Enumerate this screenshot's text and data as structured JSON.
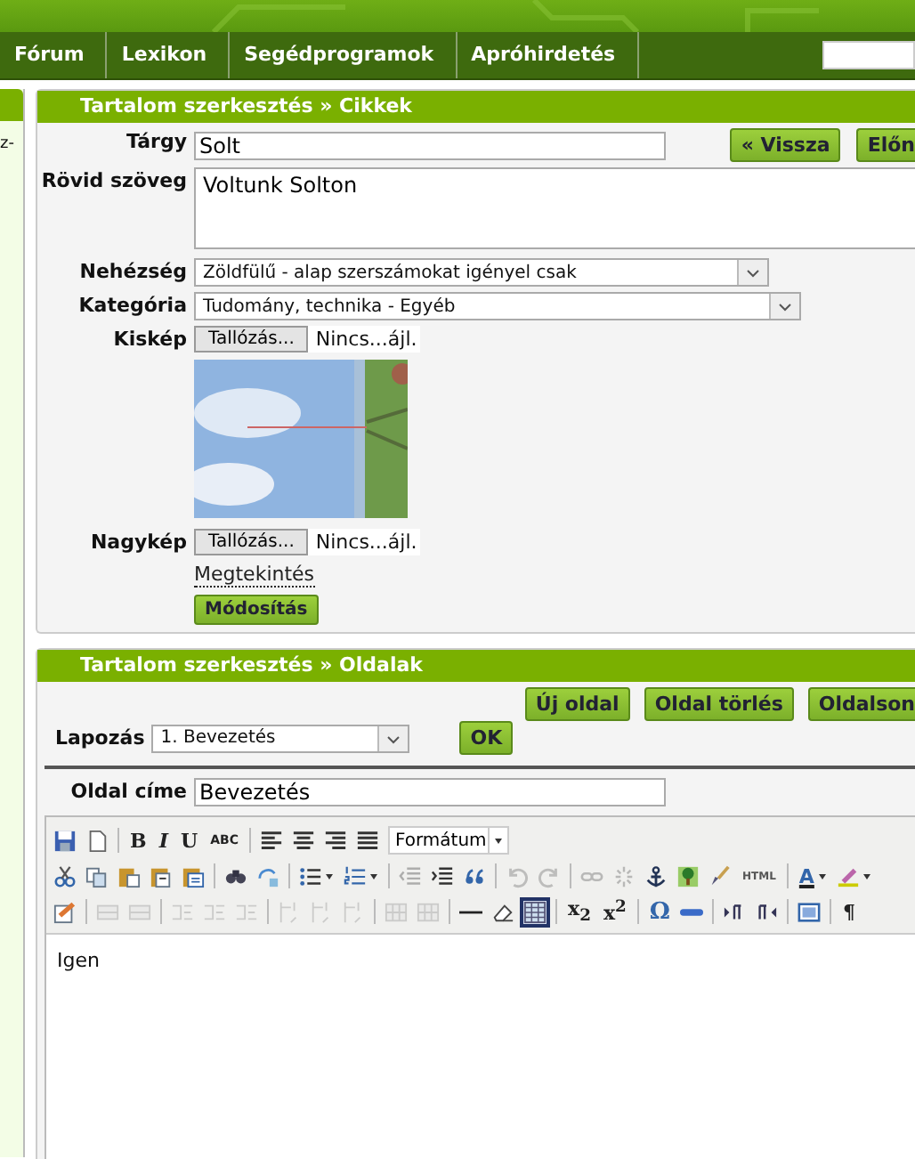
{
  "nav": {
    "items": [
      {
        "label": "Fórum"
      },
      {
        "label": "Lexikon"
      },
      {
        "label": "Segédprogramok"
      },
      {
        "label": "Apróhirdetés"
      }
    ]
  },
  "sidebar": {
    "text": "z-"
  },
  "article_panel": {
    "title": "Tartalom szerkesztés » Cikkek",
    "subject": {
      "label": "Tárgy",
      "value": "Solt"
    },
    "buttons": [
      "« Vissza",
      "Előn"
    ],
    "summary": {
      "label": "Rövid szöveg",
      "value": "Voltunk Solton"
    },
    "difficulty": {
      "label": "Nehézség",
      "value": "Zöldfülű - alap szerszámokat igényel csak"
    },
    "category": {
      "label": "Kategória",
      "value": "Tudomány, technika - Egyéb"
    },
    "small_image": {
      "label": "Kiskép",
      "button": "Tallózás...",
      "file": "Nincs...ájl."
    },
    "large_image": {
      "label": "Nagykép",
      "button": "Tallózás...",
      "file": "Nincs...ájl."
    },
    "view_link": "Megtekintés",
    "submit": "Módosítás"
  },
  "pages_panel": {
    "title": "Tartalom szerkesztés » Oldalak",
    "buttons": [
      "Új oldal",
      "Oldal törlés",
      "Oldalson"
    ],
    "paging": {
      "label": "Lapozás",
      "value": "1. Bevezetés",
      "button": "OK"
    },
    "page_title": {
      "label": "Oldal címe",
      "value": "Bevezetés"
    },
    "toolbar": [
      [
        {
          "kind": "icon",
          "disabled": false,
          "active": false
        },
        {
          "kind": "icon",
          "disabled": false,
          "active": false
        },
        {
          "kind": "sep"
        },
        {
          "kind": "glyph",
          "label": "B"
        },
        {
          "kind": "glyph",
          "label": "I"
        },
        {
          "kind": "glyph",
          "label": "U"
        },
        {
          "kind": "glyph",
          "label": "ABC"
        },
        {
          "kind": "sep"
        },
        {
          "kind": "icon",
          "disabled": false,
          "active": false
        },
        {
          "kind": "icon",
          "disabled": false,
          "active": false
        },
        {
          "kind": "icon",
          "disabled": false,
          "active": false
        },
        {
          "kind": "icon",
          "disabled": false,
          "active": false
        },
        {
          "kind": "select",
          "label": "Formátum"
        }
      ],
      [
        {
          "kind": "icon",
          "disabled": false,
          "active": false
        },
        {
          "kind": "icon",
          "disabled": false,
          "active": false
        },
        {
          "kind": "icon",
          "disabled": false,
          "active": false
        },
        {
          "kind": "icon",
          "disabled": false,
          "active": false
        },
        {
          "kind": "icon",
          "disabled": false,
          "active": false
        },
        {
          "kind": "sep"
        },
        {
          "kind": "icon",
          "disabled": false,
          "active": false
        },
        {
          "kind": "icon",
          "disabled": false,
          "active": false
        },
        {
          "kind": "sep"
        },
        {
          "kind": "icon",
          "disabled": false,
          "active": false
        },
        {
          "kind": "caret"
        },
        {
          "kind": "icon",
          "disabled": false,
          "active": false
        },
        {
          "kind": "caret"
        },
        {
          "kind": "sep"
        },
        {
          "kind": "icon",
          "disabled": true,
          "active": false
        },
        {
          "kind": "icon",
          "disabled": false,
          "active": false
        },
        {
          "kind": "icon",
          "disabled": false,
          "active": false
        },
        {
          "kind": "sep"
        },
        {
          "kind": "icon",
          "disabled": true,
          "active": false
        },
        {
          "kind": "icon",
          "disabled": true,
          "active": false
        },
        {
          "kind": "sep"
        },
        {
          "kind": "icon",
          "disabled": true,
          "active": false
        },
        {
          "kind": "icon",
          "disabled": true,
          "active": false
        },
        {
          "kind": "icon",
          "disabled": false,
          "active": false
        },
        {
          "kind": "icon",
          "disabled": false,
          "active": false
        },
        {
          "kind": "icon",
          "disabled": false,
          "active": false
        },
        {
          "kind": "glyph",
          "label": "HTML"
        },
        {
          "kind": "sep"
        },
        {
          "kind": "glyph",
          "label": "A"
        },
        {
          "kind": "caret"
        },
        {
          "kind": "icon",
          "disabled": false,
          "active": false
        },
        {
          "kind": "caret"
        }
      ],
      [
        {
          "kind": "icon",
          "disabled": false,
          "active": false
        },
        {
          "kind": "sep"
        },
        {
          "kind": "icon",
          "disabled": true,
          "active": false
        },
        {
          "kind": "icon",
          "disabled": true,
          "active": false
        },
        {
          "kind": "sep"
        },
        {
          "kind": "icon",
          "disabled": true,
          "active": false
        },
        {
          "kind": "icon",
          "disabled": true,
          "active": false
        },
        {
          "kind": "icon",
          "disabled": true,
          "active": false
        },
        {
          "kind": "sep"
        },
        {
          "kind": "icon",
          "disabled": true,
          "active": false
        },
        {
          "kind": "icon",
          "disabled": true,
          "active": false
        },
        {
          "kind": "icon",
          "disabled": true,
          "active": false
        },
        {
          "kind": "sep"
        },
        {
          "kind": "icon",
          "disabled": true,
          "active": false
        },
        {
          "kind": "icon",
          "disabled": true,
          "active": false
        },
        {
          "kind": "sep"
        },
        {
          "kind": "icon",
          "disabled": false,
          "active": false
        },
        {
          "kind": "icon",
          "disabled": false,
          "active": false
        },
        {
          "kind": "icon",
          "disabled": false,
          "active": true
        },
        {
          "kind": "sep"
        },
        {
          "kind": "glyph",
          "label": "x$_{2}$"
        },
        {
          "kind": "glyph",
          "label": "x$^{2}$"
        },
        {
          "kind": "sep"
        },
        {
          "kind": "glyph",
          "label": "Ω"
        },
        {
          "kind": "icon",
          "disabled": false,
          "active": false
        },
        {
          "kind": "sep"
        },
        {
          "kind": "icon",
          "disabled": false,
          "active": false
        },
        {
          "kind": "icon",
          "disabled": false,
          "active": false
        },
        {
          "kind": "sep"
        },
        {
          "kind": "icon",
          "disabled": false,
          "active": false
        },
        {
          "kind": "sep"
        },
        {
          "kind": "glyph",
          "label": "¶"
        }
      ]
    ],
    "editor_text": "Igen"
  }
}
